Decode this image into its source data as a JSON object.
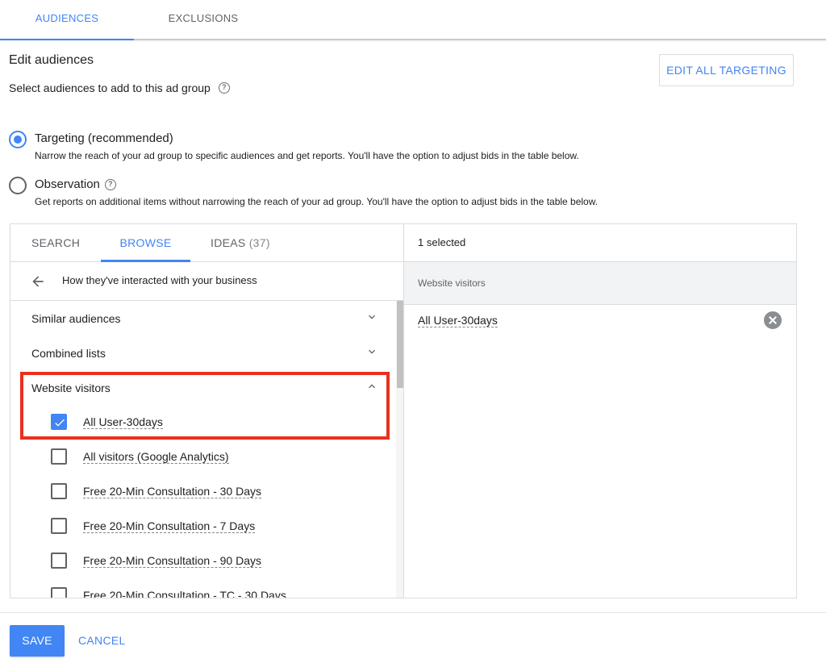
{
  "top_tabs": [
    {
      "label": "AUDIENCES",
      "active": true
    },
    {
      "label": "EXCLUSIONS",
      "active": false
    }
  ],
  "header": {
    "title": "Edit audiences",
    "subtitle": "Select audiences to add to this ad group",
    "edit_all_label": "EDIT ALL TARGETING"
  },
  "radios": [
    {
      "label": "Targeting (recommended)",
      "description": "Narrow the reach of your ad group to specific audiences and get reports. You'll have the option to adjust bids in the table below.",
      "checked": true
    },
    {
      "label": "Observation",
      "description": "Get reports on additional items without narrowing the reach of your ad group. You'll have the option to adjust bids in the table below.",
      "checked": false
    }
  ],
  "inner_tabs": {
    "search": "SEARCH",
    "browse": "BROWSE",
    "ideas": "IDEAS",
    "ideas_count": "(37)"
  },
  "breadcrumb": "How they've interacted with your business",
  "groups": {
    "similar": "Similar audiences",
    "combined": "Combined lists",
    "website": "Website visitors"
  },
  "website_items": [
    {
      "label": "All User-30days",
      "checked": true
    },
    {
      "label": "All visitors (Google Analytics)",
      "checked": false
    },
    {
      "label": "Free 20-Min Consultation - 30 Days",
      "checked": false
    },
    {
      "label": "Free 20-Min Consultation - 7 Days",
      "checked": false
    },
    {
      "label": "Free 20-Min Consultation - 90 Days",
      "checked": false
    },
    {
      "label": "Free 20-Min Consultation - TC - 30 Days",
      "checked": false
    }
  ],
  "selected_panel": {
    "count_label": "1 selected",
    "group_label": "Website visitors",
    "items": [
      "All User-30days"
    ]
  },
  "footer": {
    "save_label": "SAVE",
    "cancel_label": "CANCEL"
  },
  "colors": {
    "accent": "#4285f4",
    "highlight": "#e8301e"
  }
}
